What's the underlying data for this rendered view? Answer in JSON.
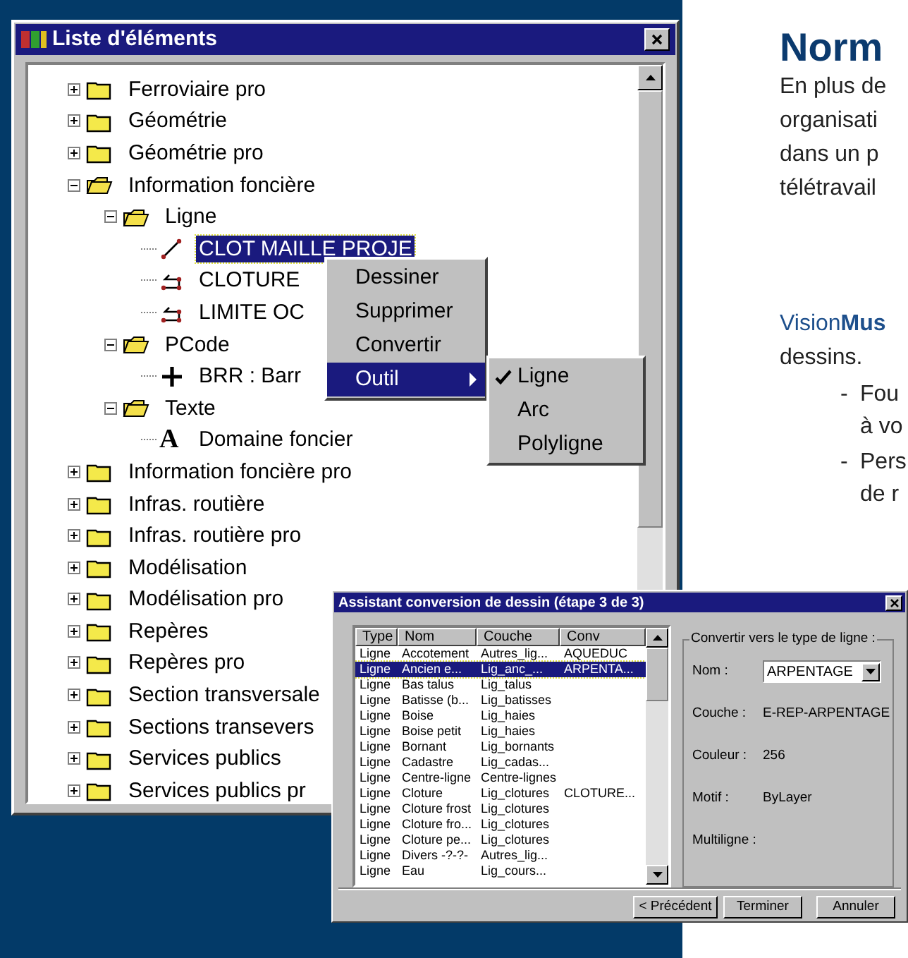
{
  "tree_window": {
    "title": "Liste d'éléments",
    "items": [
      {
        "label": "Ferroviaire pro",
        "kind": "folder",
        "expanded": false,
        "selected": false
      },
      {
        "label": "Géométrie",
        "kind": "folder",
        "expanded": false,
        "selected": false
      },
      {
        "label": "Géométrie pro",
        "kind": "folder",
        "expanded": false,
        "selected": false
      },
      {
        "label": "Information foncière",
        "kind": "folder",
        "expanded": true,
        "selected": false,
        "children": [
          {
            "label": "Ligne",
            "kind": "folder",
            "expanded": true,
            "selected": false,
            "children": [
              {
                "label": "CLOT MAILLE PROJE",
                "kind": "line",
                "selected": true
              },
              {
                "label": "CLOTURE",
                "kind": "polyline",
                "selected": false
              },
              {
                "label": "LIMITE OC",
                "kind": "polyline",
                "selected": false
              }
            ]
          },
          {
            "label": "PCode",
            "kind": "folder",
            "expanded": true,
            "selected": false,
            "children": [
              {
                "label": "BRR : Barr",
                "kind": "point",
                "selected": false
              }
            ]
          },
          {
            "label": "Texte",
            "kind": "folder",
            "expanded": true,
            "selected": false,
            "children": [
              {
                "label": "Domaine foncier",
                "kind": "text",
                "glyph": "A",
                "selected": false
              }
            ]
          }
        ]
      },
      {
        "label": "Information foncière pro",
        "kind": "folder",
        "expanded": false,
        "selected": false
      },
      {
        "label": "Infras. routière",
        "kind": "folder",
        "expanded": false,
        "selected": false
      },
      {
        "label": "Infras. routière pro",
        "kind": "folder",
        "expanded": false,
        "selected": false
      },
      {
        "label": "Modélisation",
        "kind": "folder",
        "expanded": false,
        "selected": false
      },
      {
        "label": "Modélisation pro",
        "kind": "folder",
        "expanded": false,
        "selected": false
      },
      {
        "label": "Repères",
        "kind": "folder",
        "expanded": false,
        "selected": false
      },
      {
        "label": "Repères pro",
        "kind": "folder",
        "expanded": false,
        "selected": false
      },
      {
        "label": "Section transversale",
        "kind": "folder",
        "expanded": false,
        "selected": false
      },
      {
        "label": "Sections transevers",
        "kind": "folder",
        "expanded": false,
        "selected": false
      },
      {
        "label": "Services publics",
        "kind": "folder",
        "expanded": false,
        "selected": false
      },
      {
        "label": "Services publics pr",
        "kind": "folder",
        "expanded": false,
        "selected": false
      }
    ]
  },
  "context_menu": {
    "items": [
      {
        "label": "Dessiner",
        "selected": false,
        "submenu": false
      },
      {
        "label": "Supprimer",
        "selected": false,
        "submenu": false
      },
      {
        "label": "Convertir",
        "selected": false,
        "submenu": false
      },
      {
        "label": "Outil",
        "selected": true,
        "submenu": true
      }
    ],
    "submenu": [
      {
        "label": "Ligne",
        "checked": true
      },
      {
        "label": "Arc",
        "checked": false
      },
      {
        "label": "Polyligne",
        "checked": false
      }
    ]
  },
  "dialog": {
    "title": "Assistant conversion de dessin (étape 3 de 3)",
    "columns": [
      "Type",
      "Nom",
      "Couche",
      "Conv"
    ],
    "rows": [
      {
        "cells": [
          "Ligne",
          "Accotement",
          "Autres_lig...",
          "AQUEDUC"
        ],
        "selected": false
      },
      {
        "cells": [
          "Ligne",
          "Ancien e...",
          "Lig_anc_...",
          "ARPENTA..."
        ],
        "selected": true
      },
      {
        "cells": [
          "Ligne",
          "Bas talus",
          "Lig_talus",
          ""
        ],
        "selected": false
      },
      {
        "cells": [
          "Ligne",
          "Batisse (b...",
          "Lig_batisses",
          ""
        ],
        "selected": false
      },
      {
        "cells": [
          "Ligne",
          "Boise",
          "Lig_haies",
          ""
        ],
        "selected": false
      },
      {
        "cells": [
          "Ligne",
          "Boise petit",
          "Lig_haies",
          ""
        ],
        "selected": false
      },
      {
        "cells": [
          "Ligne",
          "Bornant",
          "Lig_bornants",
          ""
        ],
        "selected": false
      },
      {
        "cells": [
          "Ligne",
          "Cadastre",
          "Lig_cadas...",
          ""
        ],
        "selected": false
      },
      {
        "cells": [
          "Ligne",
          "Centre-ligne",
          "Centre-lignes",
          ""
        ],
        "selected": false
      },
      {
        "cells": [
          "Ligne",
          "Cloture",
          "Lig_clotures",
          "CLOTURE..."
        ],
        "selected": false
      },
      {
        "cells": [
          "Ligne",
          "Cloture frost",
          "Lig_clotures",
          ""
        ],
        "selected": false
      },
      {
        "cells": [
          "Ligne",
          "Cloture fro...",
          "Lig_clotures",
          ""
        ],
        "selected": false
      },
      {
        "cells": [
          "Ligne",
          "Cloture pe...",
          "Lig_clotures",
          ""
        ],
        "selected": false
      },
      {
        "cells": [
          "Ligne",
          "Divers -?-?-",
          "Autres_lig...",
          ""
        ],
        "selected": false
      },
      {
        "cells": [
          "Ligne",
          "Eau",
          "Lig_cours...",
          ""
        ],
        "selected": false
      }
    ],
    "group_title": "Convertir vers le type de ligne :",
    "fields": [
      {
        "label": "Nom :",
        "value": "ARPENTAGE",
        "kind": "dropdown"
      },
      {
        "label": "Couche :",
        "value": "E-REP-ARPENTAGE",
        "kind": "text"
      },
      {
        "label": "Couleur :",
        "value": "256",
        "kind": "text"
      },
      {
        "label": "Motif :",
        "value": "ByLayer",
        "kind": "text"
      },
      {
        "label": "Multiligne :",
        "kind": "text"
      }
    ],
    "buttons": [
      "< Précédent",
      "Terminer",
      "Annuler"
    ]
  },
  "article": {
    "heading": "Norm",
    "paragraph_lines": [
      "En plus de",
      "organisati",
      "dans un p",
      "télétravail"
    ],
    "intro_lines": [
      "Vision**Mus**",
      "dessins."
    ],
    "bullets": [
      {
        "marker": "-",
        "lines": [
          "Fou",
          "à vo"
        ]
      },
      {
        "marker": "-",
        "lines": [
          "Pers",
          "de r"
        ]
      }
    ]
  }
}
